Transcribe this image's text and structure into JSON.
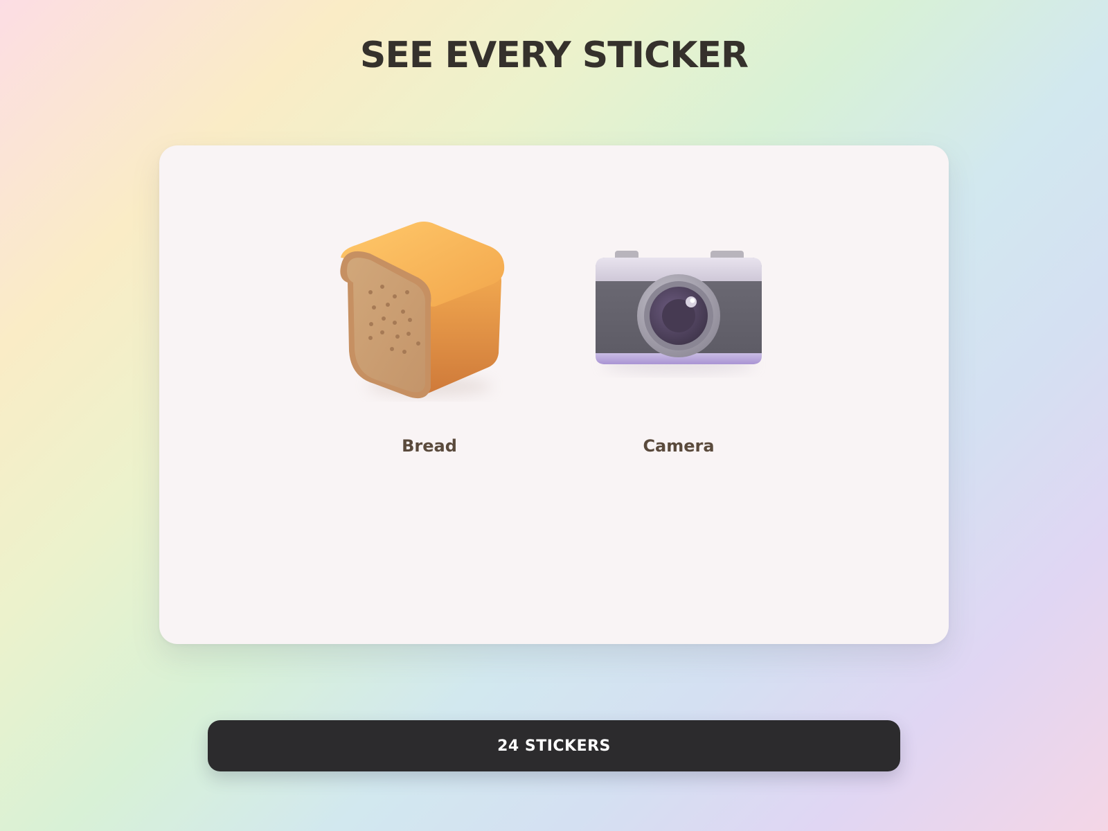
{
  "header": {
    "title": "SEE EVERY STICKER"
  },
  "stickers": [
    {
      "label": "Bread",
      "icon": "bread-icon"
    },
    {
      "label": "Camera",
      "icon": "camera-icon"
    }
  ],
  "footer": {
    "count_label": "24 STICKERS"
  }
}
